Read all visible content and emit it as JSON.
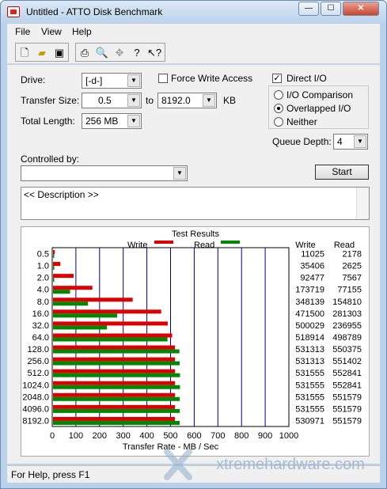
{
  "window": {
    "title": "Untitled - ATTO Disk Benchmark",
    "min": "—",
    "max": "☐",
    "close": "✕"
  },
  "menu": {
    "items": [
      "File",
      "View",
      "Help"
    ]
  },
  "toolbar": {
    "icons": [
      "new-document-icon",
      "open-folder-icon",
      "save-icon",
      "print-icon",
      "print-preview-icon",
      "move-icon",
      "help-icon",
      "context-help-icon"
    ]
  },
  "form": {
    "drive_label": "Drive:",
    "drive_value": "[-d-]",
    "force_write_label": "Force Write Access",
    "force_write_checked": false,
    "direct_io_label": "Direct I/O",
    "direct_io_checked": true,
    "transfer_size_label": "Transfer Size:",
    "transfer_from": "0.5",
    "to_label": "to",
    "transfer_to": "8192.0",
    "kb_label": "KB",
    "total_length_label": "Total Length:",
    "total_length_value": "256 MB",
    "io_comparison_label": "I/O Comparison",
    "overlapped_io_label": "Overlapped I/O",
    "neither_label": "Neither",
    "selected_io_mode": "Overlapped I/O",
    "queue_depth_label": "Queue Depth:",
    "queue_depth_value": "4",
    "controlled_by_label": "Controlled by:",
    "controlled_by_value": "",
    "start_label": "Start",
    "description_text": "<< Description >>"
  },
  "results": {
    "title": "Test Results",
    "write_legend": "Write",
    "read_legend": "Read",
    "write_col": "Write",
    "read_col": "Read",
    "colors": {
      "write": "#dd0000",
      "read": "#008800"
    }
  },
  "chart_data": {
    "type": "bar",
    "orientation": "horizontal",
    "title": "Test Results",
    "xlabel": "Transfer Rate - MB / Sec",
    "xlim": [
      0,
      1000
    ],
    "xticks": [
      "0",
      "100",
      "200",
      "300",
      "400",
      "500",
      "600",
      "700",
      "800",
      "900",
      "1000"
    ],
    "categories": [
      "0.5",
      "1.0",
      "2.0",
      "4.0",
      "8.0",
      "16.0",
      "32.0",
      "64.0",
      "128.0",
      "256.0",
      "512.0",
      "1024.0",
      "2048.0",
      "4096.0",
      "8192.0"
    ],
    "series": [
      {
        "name": "Write",
        "values": [
          11025,
          35406,
          92477,
          173719,
          348139,
          471500,
          500029,
          518914,
          531313,
          531313,
          531555,
          531555,
          531555,
          531555,
          530971
        ]
      },
      {
        "name": "Read",
        "values": [
          2178,
          2625,
          7567,
          77155,
          154810,
          281303,
          236955,
          498789,
          550375,
          551402,
          552841,
          552841,
          551579,
          551579,
          551579
        ]
      }
    ],
    "value_labels": {
      "write": [
        "11025",
        "35406",
        "92477",
        "173719",
        "348139",
        "471500",
        "500029",
        "518914",
        "531313",
        "531313",
        "531555",
        "531555",
        "531555",
        "531555",
        "530971"
      ],
      "read": [
        "2178",
        "2625",
        "7567",
        "77155",
        "154810",
        "281303",
        "236955",
        "498789",
        "550375",
        "551402",
        "552841",
        "552841",
        "551579",
        "551579",
        "551579"
      ]
    },
    "grid": true,
    "legend_position": "top"
  },
  "status": {
    "text": "For Help, press F1"
  },
  "watermark": {
    "text": "xtremehardware.com"
  }
}
